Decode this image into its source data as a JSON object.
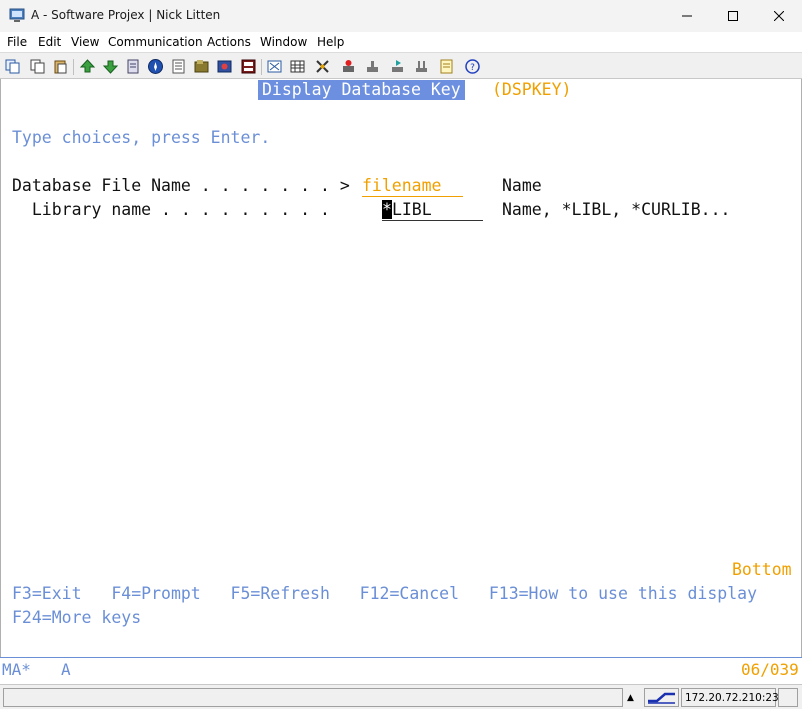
{
  "window": {
    "title": "A - Software Projex | Nick Litten"
  },
  "menu": [
    "File",
    "Edit",
    "View",
    "Communication",
    "Actions",
    "Window",
    "Help"
  ],
  "toolbar_icons": [
    "copy-icon",
    "copy-append-icon",
    "paste-icon",
    "send-file-icon",
    "receive-file-icon",
    "print-screen-icon",
    "navigator-icon",
    "trace-icon",
    "macro-record-icon",
    "macro-play-icon",
    "display-icon",
    "keypad-icon",
    "keyboard-map-icon",
    "macro-icon",
    "stop-record-icon",
    "download-icon",
    "play-icon",
    "status-icon",
    "notes-icon",
    "help-icon"
  ],
  "screen": {
    "title": "Display Database Key",
    "command": "(DSPKEY)",
    "instructions": "Type choices, press Enter.",
    "fields": [
      {
        "label": "Database File Name . . . . . . . >",
        "value": "filename",
        "hint": "Name"
      },
      {
        "label": "  Library name . . . . . . . . .",
        "value_cursor": "*",
        "value": "LIBL",
        "hint": "Name, *LIBL, *CURLIB..."
      }
    ],
    "bottom_indicator": "Bottom",
    "function_keys_line1": "F3=Exit   F4=Prompt   F5=Refresh   F12=Cancel   F13=How to use this display",
    "function_keys_line2": "F24=More keys"
  },
  "oia": {
    "left": "MA*",
    "session": "A",
    "cursor_pos": "06/039"
  },
  "statusbar": {
    "host": "172.20.72.210:23"
  },
  "colors": {
    "terminal_blue": "#6b8fd6",
    "terminal_orange": "#f0a000",
    "title_highlight": "#6d8fe0"
  }
}
